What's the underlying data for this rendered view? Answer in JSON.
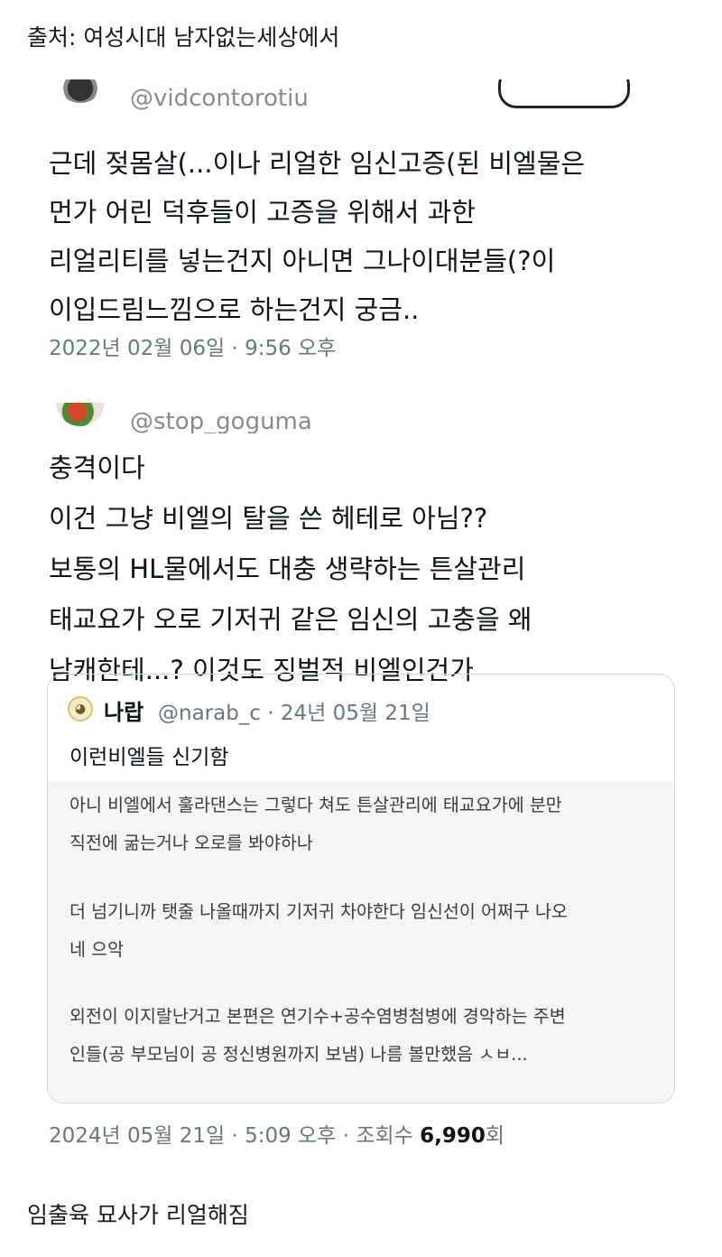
{
  "header": {
    "source_text": "출처: 여성시대 남자없는세상에서"
  },
  "tweet1": {
    "handle_partial": "@vidcontorotiu",
    "lines": [
      "근데 젖몸살(...이나 리얼한 임신고증(된 비엘물은",
      "먼가 어린 덕후들이  고증을 위해서 과한",
      "리얼리티를 넣는건지 아니면 그나이대분들(?이",
      "이입드림느낌으로 하는건지 궁금.."
    ],
    "timestamp": "2022년 02월 06일 · 9:56 오후"
  },
  "tweet2": {
    "handle_partial": "@stop_goguma",
    "lines": [
      "충격이다",
      "이건 그냥 비엘의 탈을 쓴 헤테로 아님??",
      "보통의 HL물에서도 대충 생략하는 튼살관리",
      "태교요가 오로 기저귀 같은 임신의 고충을 왜",
      "남캐한테...? 이것도 징벌적 비엘인건가"
    ],
    "timestamp": "2024년 05월 21일 · 5:09 오후 · 조회수 ",
    "views": "6,990",
    "views_unit": "회"
  },
  "quote": {
    "name": "나랍",
    "handle_date": "@narab_c · 24년 05월 21일",
    "title": "이런비엘들 신기함",
    "paragraphs": [
      [
        "아니 비엘에서 훌라댄스는 그렇다 쳐도 튼살관리에 태교요가에 분만",
        "직전에 굶는거나 오로를 봐야하나"
      ],
      [
        "더 넘기니까 탯줄 나올때까지 기저귀 차야한다 임신선이 어쩌구 나오",
        "네 으악"
      ],
      [
        "외전이 이지랄난거고 본편은 연기수+공수염병첨병에 경악하는 주변",
        "인들(공 부모님이 공 정신병원까지 보냄) 나름 볼만했음 ㅅㅂ..."
      ]
    ]
  },
  "footer": {
    "caption": "임출육 묘사가 리얼해짐"
  },
  "colors": {
    "meta_gray": "#6b7580",
    "card_border": "#cfd9de",
    "card_body_bg": "#f5f5f5"
  }
}
